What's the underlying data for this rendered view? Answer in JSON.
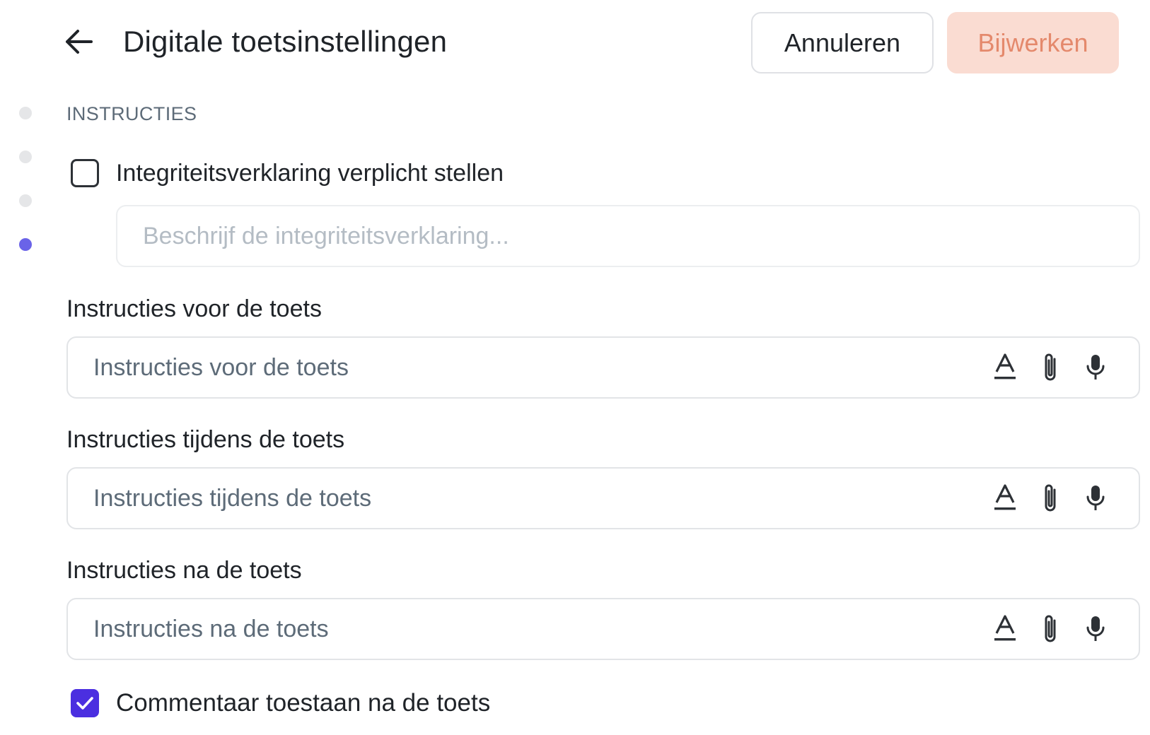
{
  "header": {
    "title": "Digitale toetsinstellingen",
    "cancel_label": "Annuleren",
    "update_label": "Bijwerken"
  },
  "progress": {
    "steps": 4,
    "active_step": 4
  },
  "section": {
    "label": "INSTRUCTIES"
  },
  "integrity": {
    "checkbox_label": "Integriteitsverklaring verplicht stellen",
    "checked": false,
    "placeholder": "Beschrijf de integriteitsverklaring..."
  },
  "fields": [
    {
      "label": "Instructies voor de toets",
      "placeholder": "Instructies voor de toets"
    },
    {
      "label": "Instructies tijdens de toets",
      "placeholder": "Instructies tijdens de toets"
    },
    {
      "label": "Instructies na de toets",
      "placeholder": "Instructies na de toets"
    }
  ],
  "comments": {
    "checkbox_label": "Commentaar toestaan na de toets",
    "checked": true
  },
  "icons": {
    "back": "arrow-left-icon",
    "format": "text-format-icon",
    "attach": "paperclip-icon",
    "mic": "microphone-icon",
    "check": "checkmark-icon"
  },
  "colors": {
    "accent": "#4b2fe0",
    "active_dot": "#6a63e8",
    "update_bg": "#fadcd2",
    "update_text": "#e4896c"
  }
}
